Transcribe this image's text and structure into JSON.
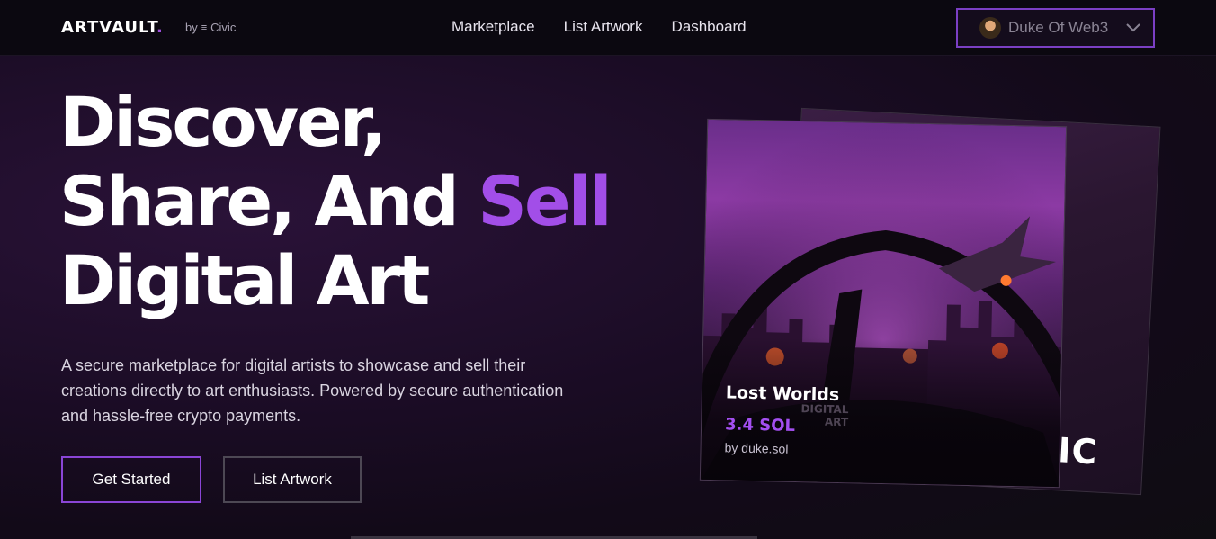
{
  "header": {
    "logo_text": "ARTVAULT",
    "logo_dot": ".",
    "byline_prefix": "by",
    "byline_brand": "Civic",
    "nav": [
      {
        "label": "Marketplace"
      },
      {
        "label": "List Artwork"
      },
      {
        "label": "Dashboard"
      }
    ],
    "user": {
      "name": "Duke Of Web3"
    }
  },
  "hero": {
    "title_line1": "Discover,",
    "title_line2": "Share, And",
    "title_accent": "Sell",
    "title_line3": "Digital Art",
    "description": "A secure marketplace for digital artists to showcase and sell their creations directly to art enthusiasts. Powered by secure authentication and hassle-free crypto payments.",
    "primary_cta": "Get Started",
    "secondary_cta": "List Artwork"
  },
  "featured_art": {
    "title": "Lost Worlds",
    "price": "3.4 SOL",
    "artist": "by duke.sol",
    "watermark_line1": "DIGITAL",
    "watermark_line2": "ART",
    "back_card_mark": "VIC"
  },
  "colors": {
    "accent": "#a24ee8",
    "button_border": "#8a45d6",
    "user_menu_border": "#7b3fc4",
    "background": "#1a0c24"
  },
  "icons": {
    "civic": "civic-icon",
    "chevron": "chevron-down-icon"
  }
}
